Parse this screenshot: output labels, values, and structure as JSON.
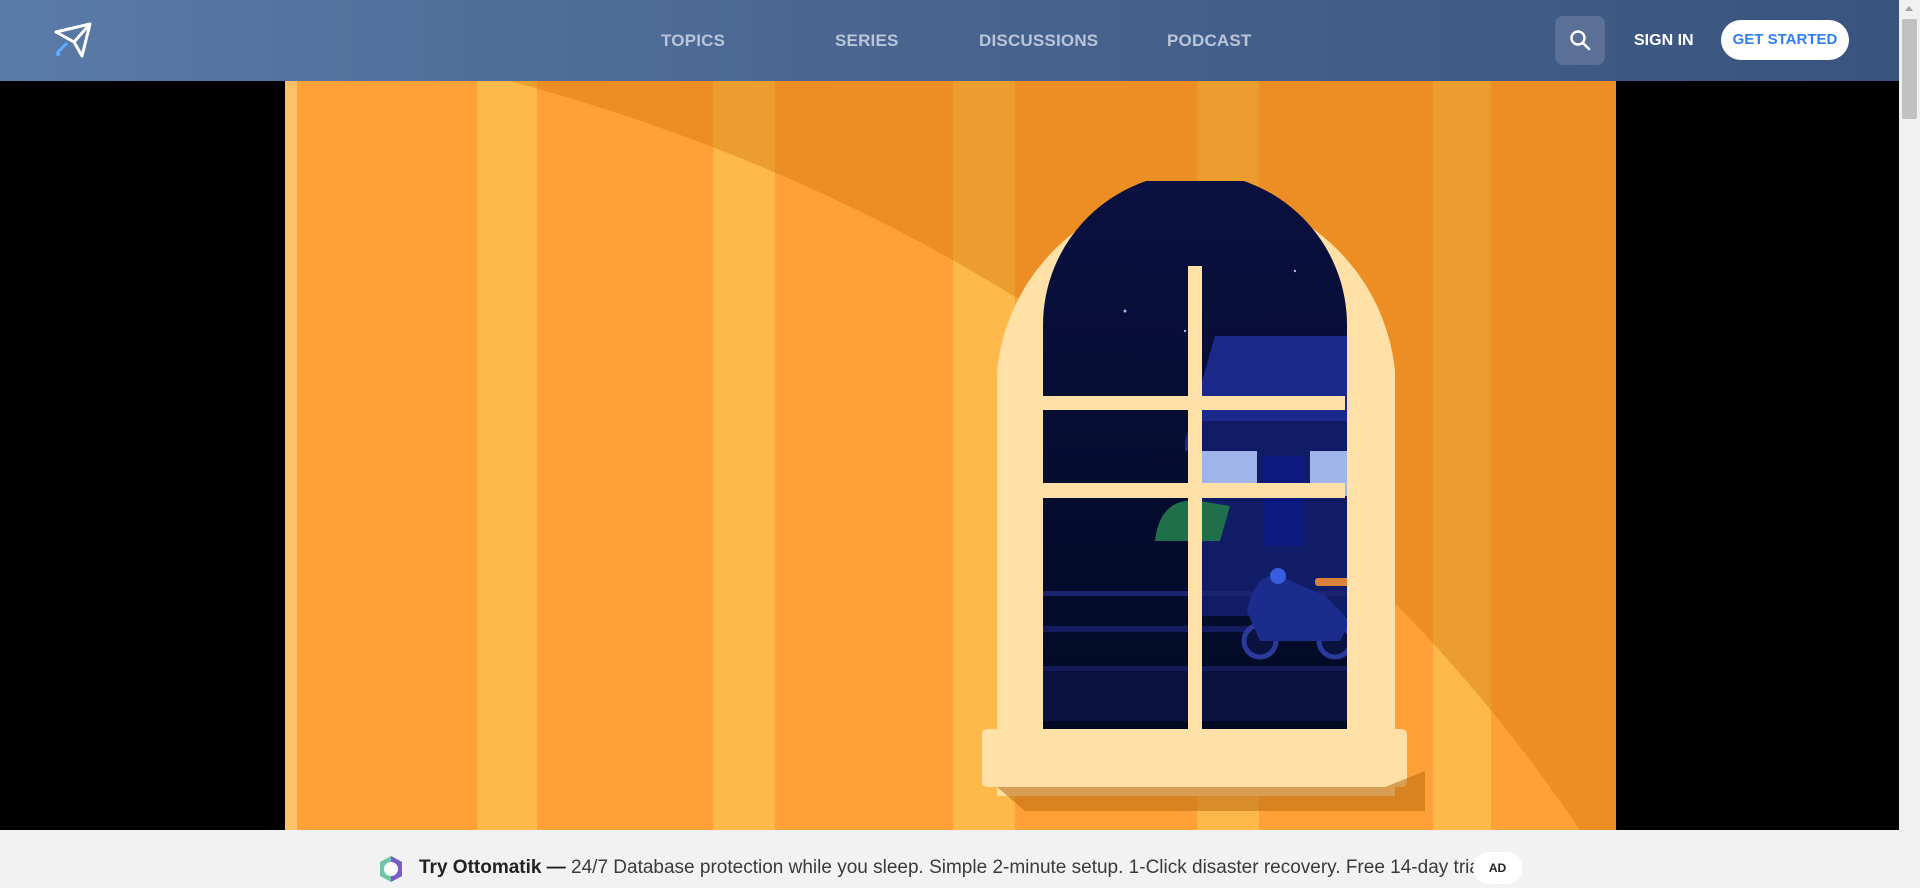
{
  "nav": {
    "items": [
      {
        "label": "TOPICS"
      },
      {
        "label": "SERIES"
      },
      {
        "label": "DISCUSSIONS"
      },
      {
        "label": "PODCAST"
      }
    ],
    "search_icon": "search-icon",
    "sign_in_label": "SIGN IN",
    "get_started_label": "GET STARTED"
  },
  "ad": {
    "brand": "Try Ottomatik —",
    "text": " 24/7 Database protection while you sleep. Simple 2-minute setup. 1-Click disaster recovery. Free 14-day trial.",
    "badge": "AD",
    "icon": "ottomatik-logo-icon"
  },
  "colors": {
    "header": "#4a6590",
    "accent": "#2f80ed",
    "video_background": "#ffa136"
  }
}
